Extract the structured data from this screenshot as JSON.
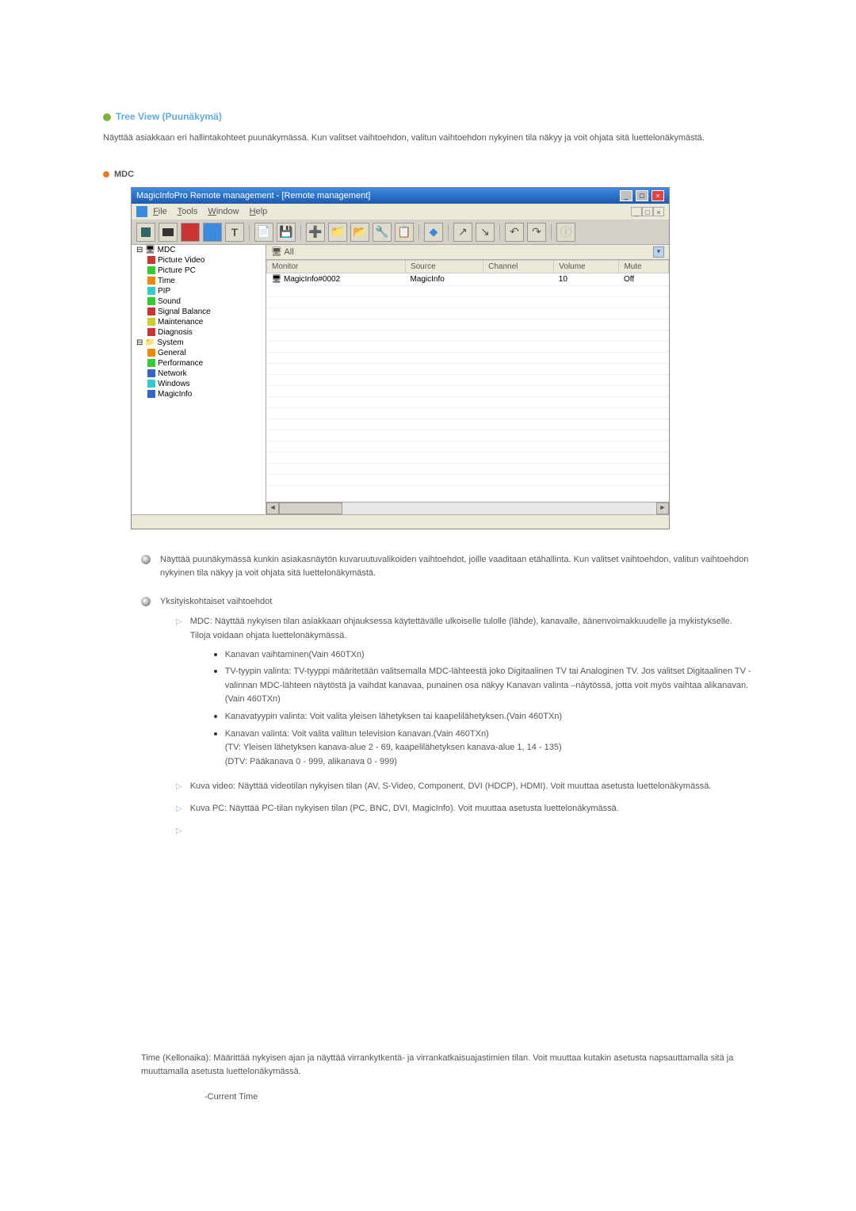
{
  "section": {
    "title": "Tree View (Puunäkymä)",
    "intro": "Näyttää asiakkaan eri hallintakohteet puunäkymässä. Kun valitset vaihtoehdon, valitun vaihtoehdon nykyinen tila näkyy ja voit ohjata sitä luettelonäkymästä."
  },
  "mdc_heading": "MDC",
  "window": {
    "title": "MagicInfoPro Remote management - [Remote management]",
    "menu": {
      "file": "File",
      "tools": "Tools",
      "window": "Window",
      "help": "Help"
    },
    "win_ctrl_restore": "_",
    "win_ctrl_max": "□",
    "win_ctrl_close": "×",
    "toolbar_T": "T",
    "tree": {
      "root": "MDC",
      "items": [
        "Picture Video",
        "Picture PC",
        "Time",
        "PIP",
        "Sound",
        "Signal Balance",
        "Maintenance",
        "Diagnosis"
      ],
      "system": "System",
      "system_items": [
        "General",
        "Performance",
        "Network",
        "Windows",
        "MagicInfo"
      ]
    },
    "list": {
      "all": "All",
      "headers": [
        "Monitor",
        "Source",
        "Channel",
        "Volume",
        "Mute"
      ],
      "row": {
        "monitor": "MagicInfo#0002",
        "source": "MagicInfo",
        "channel": "",
        "volume": "10",
        "mute": "Off"
      }
    }
  },
  "details": {
    "d1": "Näyttää puunäkymässä kunkin asiakasnäytön kuvaruutuvalikoiden vaihtoehdot, joille vaaditaan etähallinta. Kun valitset vaihtoehdon, valitun vaihtoehdon nykyinen tila näkyy ja voit ohjata sitä luettelonäkymästä.",
    "d2_title": "Yksityiskohtaiset vaihtoehdot",
    "d2_mdc": "MDC: Näyttää nykyisen tilan asiakkaan ohjauksessa käytettävälle ulkoiselle tulolle (lähde), kanavalle, äänenvoimakkuudelle ja mykistykselle. Tiloja voidaan ohjata luettelonäkymässä.",
    "b1": "Kanavan vaihtaminen(Vain 460TXn)",
    "b2": "TV-tyypin valinta: TV-tyyppi määritetään valitsemalla MDC-lähteestä joko Digitaalinen TV tai Analoginen TV. Jos valitset Digitaalinen TV -valinnan MDC-lähteen näytöstä ja vaihdat kanavaa, punainen osa näkyy Kanavan valinta –näytössä, jotta voit myös vaihtaa alikanavan.(Vain 460TXn)",
    "b3": "Kanavatyypin valinta: Voit valita yleisen lähetyksen tai kaapelilähetyksen.(Vain 460TXn)",
    "b4a": "Kanavan valinta: Voit valita valitun television kanavan.(Vain 460TXn)",
    "b4b": "(TV: Yleisen lähetyksen kanava-alue 2 - 69, kaapelilähetyksen kanava-alue 1, 14 - 135)",
    "b4c": "(DTV: Pääkanava 0 - 999, alikanava 0 - 999)",
    "d2_kuva_video": "Kuva video: Näyttää videotilan nykyisen tilan (AV, S-Video, Component, DVI (HDCP), HDMI). Voit muuttaa asetusta luettelonäkymässä.",
    "d2_kuva_pc": "Kuva PC: Näyttää PC-tilan nykyisen tilan (PC, BNC, DVI, MagicInfo). Voit muuttaa asetusta luettelonäkymässä."
  },
  "time": {
    "text": "Time (Kellonaika): Määrittää nykyisen ajan ja näyttää virrankytkentä- ja virrankatkaisuajastimien tilan. Voit muuttaa kutakin asetusta napsauttamalla sitä ja muuttamalla asetusta luettelonäkymässä.",
    "sub": "-Current Time"
  }
}
